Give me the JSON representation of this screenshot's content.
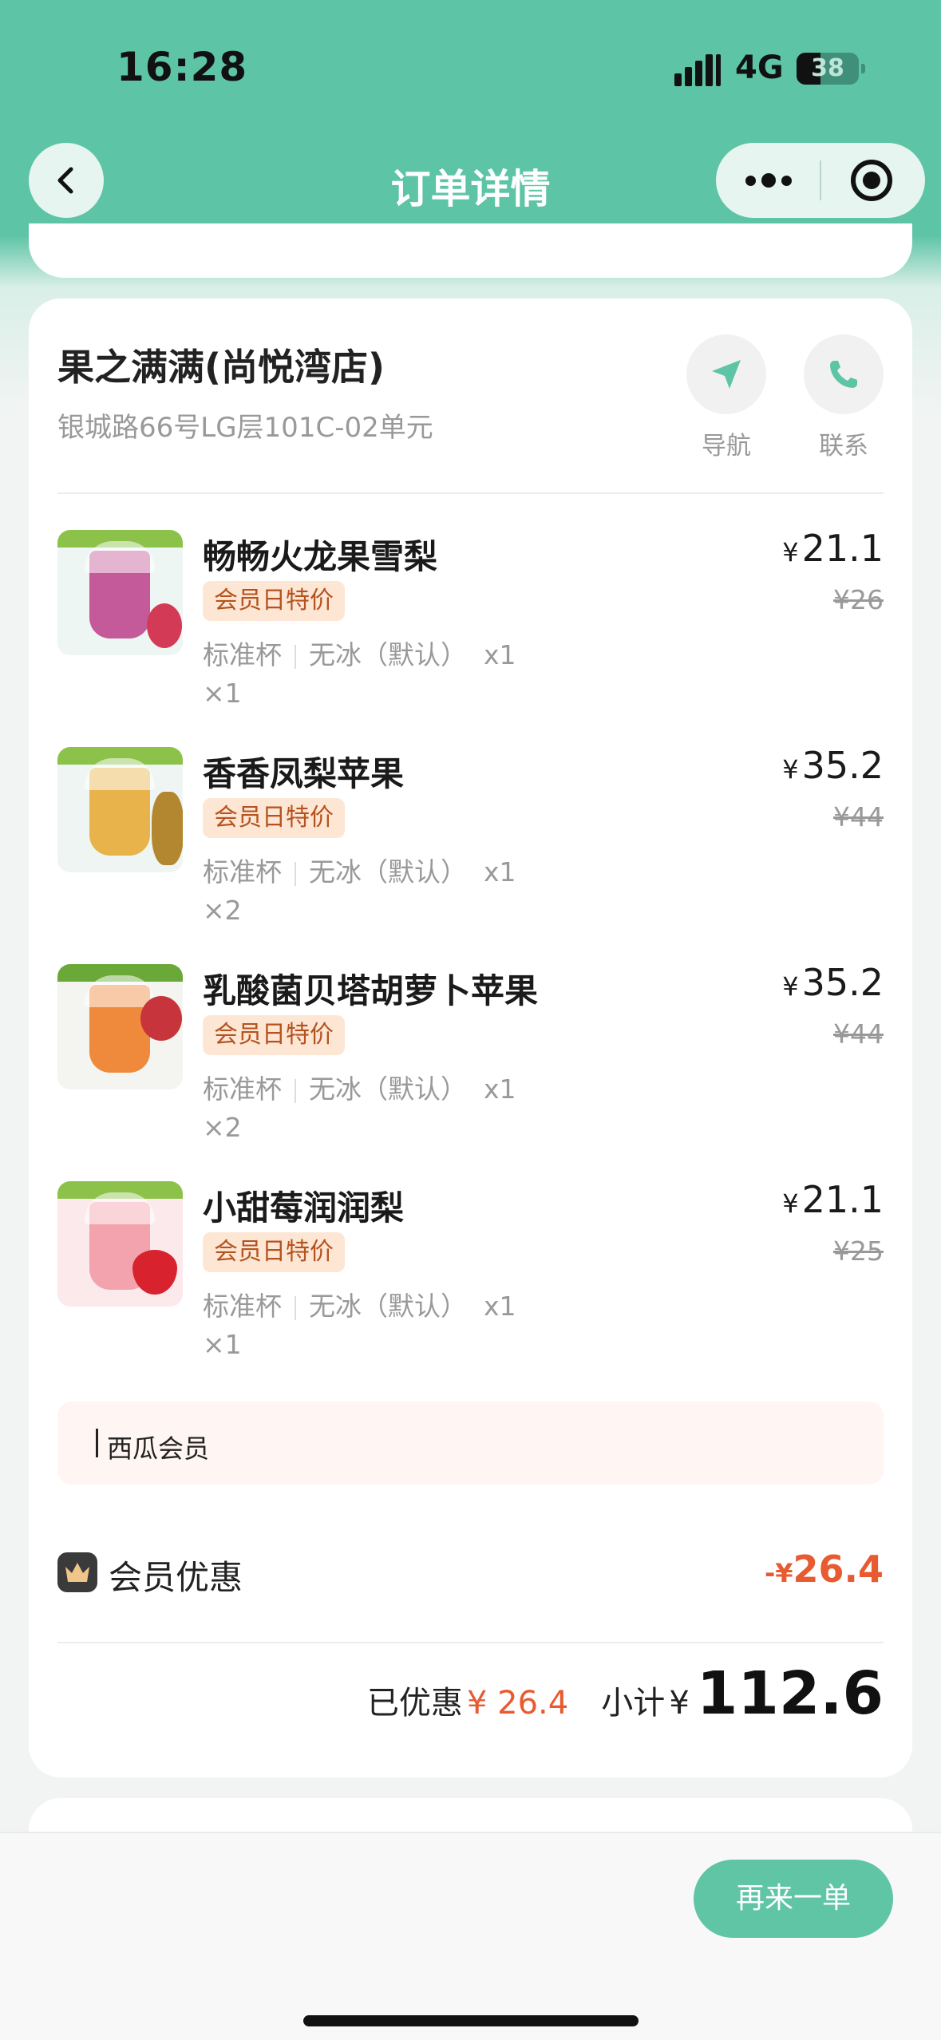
{
  "status_bar": {
    "time": "16:28",
    "network": "4G",
    "battery": "38",
    "battery_level": 0.38
  },
  "nav": {
    "title": "订单详情",
    "back_icon": "chevron-left-icon",
    "more_icon": "more-dots-icon",
    "target_icon": "record-target-icon"
  },
  "store": {
    "name": "果之满满(尚悦湾店)",
    "address": "银城路66号LG层101C-02单元",
    "navigate_label": "导航",
    "contact_label": "联系"
  },
  "items": [
    {
      "name": "畅畅火龙果雪梨",
      "badge": "会员日特价",
      "spec_size": "标准杯",
      "spec_ice": "无冰（默认）",
      "spec_qty": "x1",
      "qty": "×1",
      "price_symbol": "¥",
      "price": "21.1",
      "original": "¥26",
      "colors": {
        "band": "#8cc24a",
        "cup": "#c55a9a",
        "bg": "#eef6f4",
        "fruit": "#d33a55"
      }
    },
    {
      "name": "香香凤梨苹果",
      "badge": "会员日特价",
      "spec_size": "标准杯",
      "spec_ice": "无冰（默认）",
      "spec_qty": "x1",
      "qty": "×2",
      "price_symbol": "¥",
      "price": "35.2",
      "original": "¥44",
      "colors": {
        "band": "#8cc24a",
        "cup": "#e8b34a",
        "bg": "#eef5f3",
        "fruit": "#b3872f"
      }
    },
    {
      "name": "乳酸菌贝塔胡萝卜苹果",
      "badge": "会员日特价",
      "spec_size": "标准杯",
      "spec_ice": "无冰（默认）",
      "spec_qty": "x1",
      "qty": "×2",
      "price_symbol": "¥",
      "price": "35.2",
      "original": "¥44",
      "colors": {
        "band": "#6aa838",
        "cup": "#ef8a3c",
        "bg": "#f4f5f0",
        "fruit": "#c7343b"
      }
    },
    {
      "name": "小甜莓润润梨",
      "badge": "会员日特价",
      "spec_size": "标准杯",
      "spec_ice": "无冰（默认）",
      "spec_qty": "x1",
      "qty": "×1",
      "price_symbol": "¥",
      "price": "21.1",
      "original": "¥25",
      "colors": {
        "band": "#8cc24a",
        "cup": "#f2a3ad",
        "bg": "#fbe9ec",
        "fruit": "#d8232e"
      }
    }
  ],
  "member_box": {
    "text": "西瓜会员"
  },
  "discount": {
    "label": "会员优惠",
    "prefix": "-",
    "symbol": "¥",
    "value": "26.4"
  },
  "totals": {
    "saved_label": "已优惠",
    "saved_value": "¥ 26.4",
    "subtotal_label": "小计",
    "subtotal_symbol": "¥",
    "subtotal_value": "112.6"
  },
  "bottom": {
    "reorder_label": "再来一单"
  },
  "theme": {
    "primary": "#5dc4a5",
    "accent": "#e85a30",
    "badge_bg": "#fde6d4",
    "badge_text": "#b5531f"
  }
}
